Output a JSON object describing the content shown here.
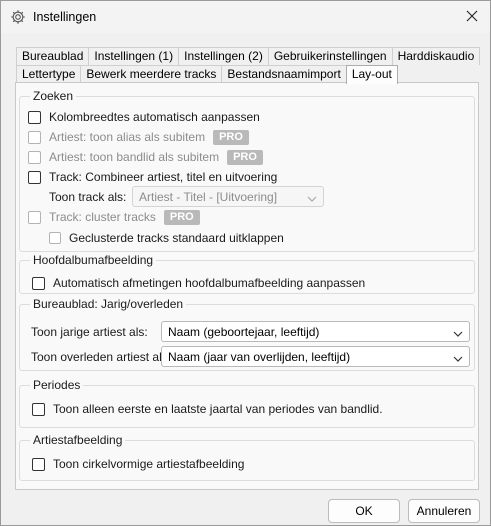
{
  "window": {
    "title": "Instellingen",
    "icon": "gear-icon",
    "close_icon": "close-icon"
  },
  "tabs_row1": [
    "Bureaublad",
    "Instellingen (1)",
    "Instellingen (2)",
    "Gebruikerinstellingen",
    "Harddiskaudio"
  ],
  "tabs_row2": [
    "Lettertype",
    "Bewerk meerdere tracks",
    "Bestandsnaamimport",
    "Lay-out"
  ],
  "active_tab": "Lay-out",
  "zoeken": {
    "title": "Zoeken",
    "kolombreedtes": "Kolombreedtes automatisch aanpassen",
    "artiest_alias": "Artiest: toon alias als subitem",
    "artiest_bandlid": "Artiest: toon bandlid als subitem",
    "track_combineer": "Track: Combineer artiest, titel en uitvoering",
    "toon_track_label": "Toon track als:",
    "toon_track_value": "Artiest - Titel - [Uitvoering]",
    "track_cluster": "Track: cluster tracks",
    "geclusterde": "Geclusterde tracks standaard uitklappen",
    "pro_badge": "PRO"
  },
  "hoofdalbum": {
    "title": "Hoofdalbumafbeelding",
    "auto_afmetingen": "Automatisch afmetingen hoofdalbumafbeelding aanpassen"
  },
  "bureaublad": {
    "title": "Bureaublad: Jarig/overleden",
    "jarig_label": "Toon jarige artiest als:",
    "jarig_value": "Naam (geboortejaar, leeftijd)",
    "overleden_label": "Toon overleden artiest als:",
    "overleden_value": "Naam (jaar van overlijden, leeftijd)"
  },
  "periodes": {
    "title": "Periodes",
    "toon_jaartal": "Toon alleen eerste en laatste jaartal van periodes van bandlid."
  },
  "artiestafbeelding": {
    "title": "Artiestafbeelding",
    "cirkelvormig": "Toon cirkelvormige artiestafbeelding"
  },
  "buttons": {
    "ok": "OK",
    "cancel": "Annuleren"
  }
}
